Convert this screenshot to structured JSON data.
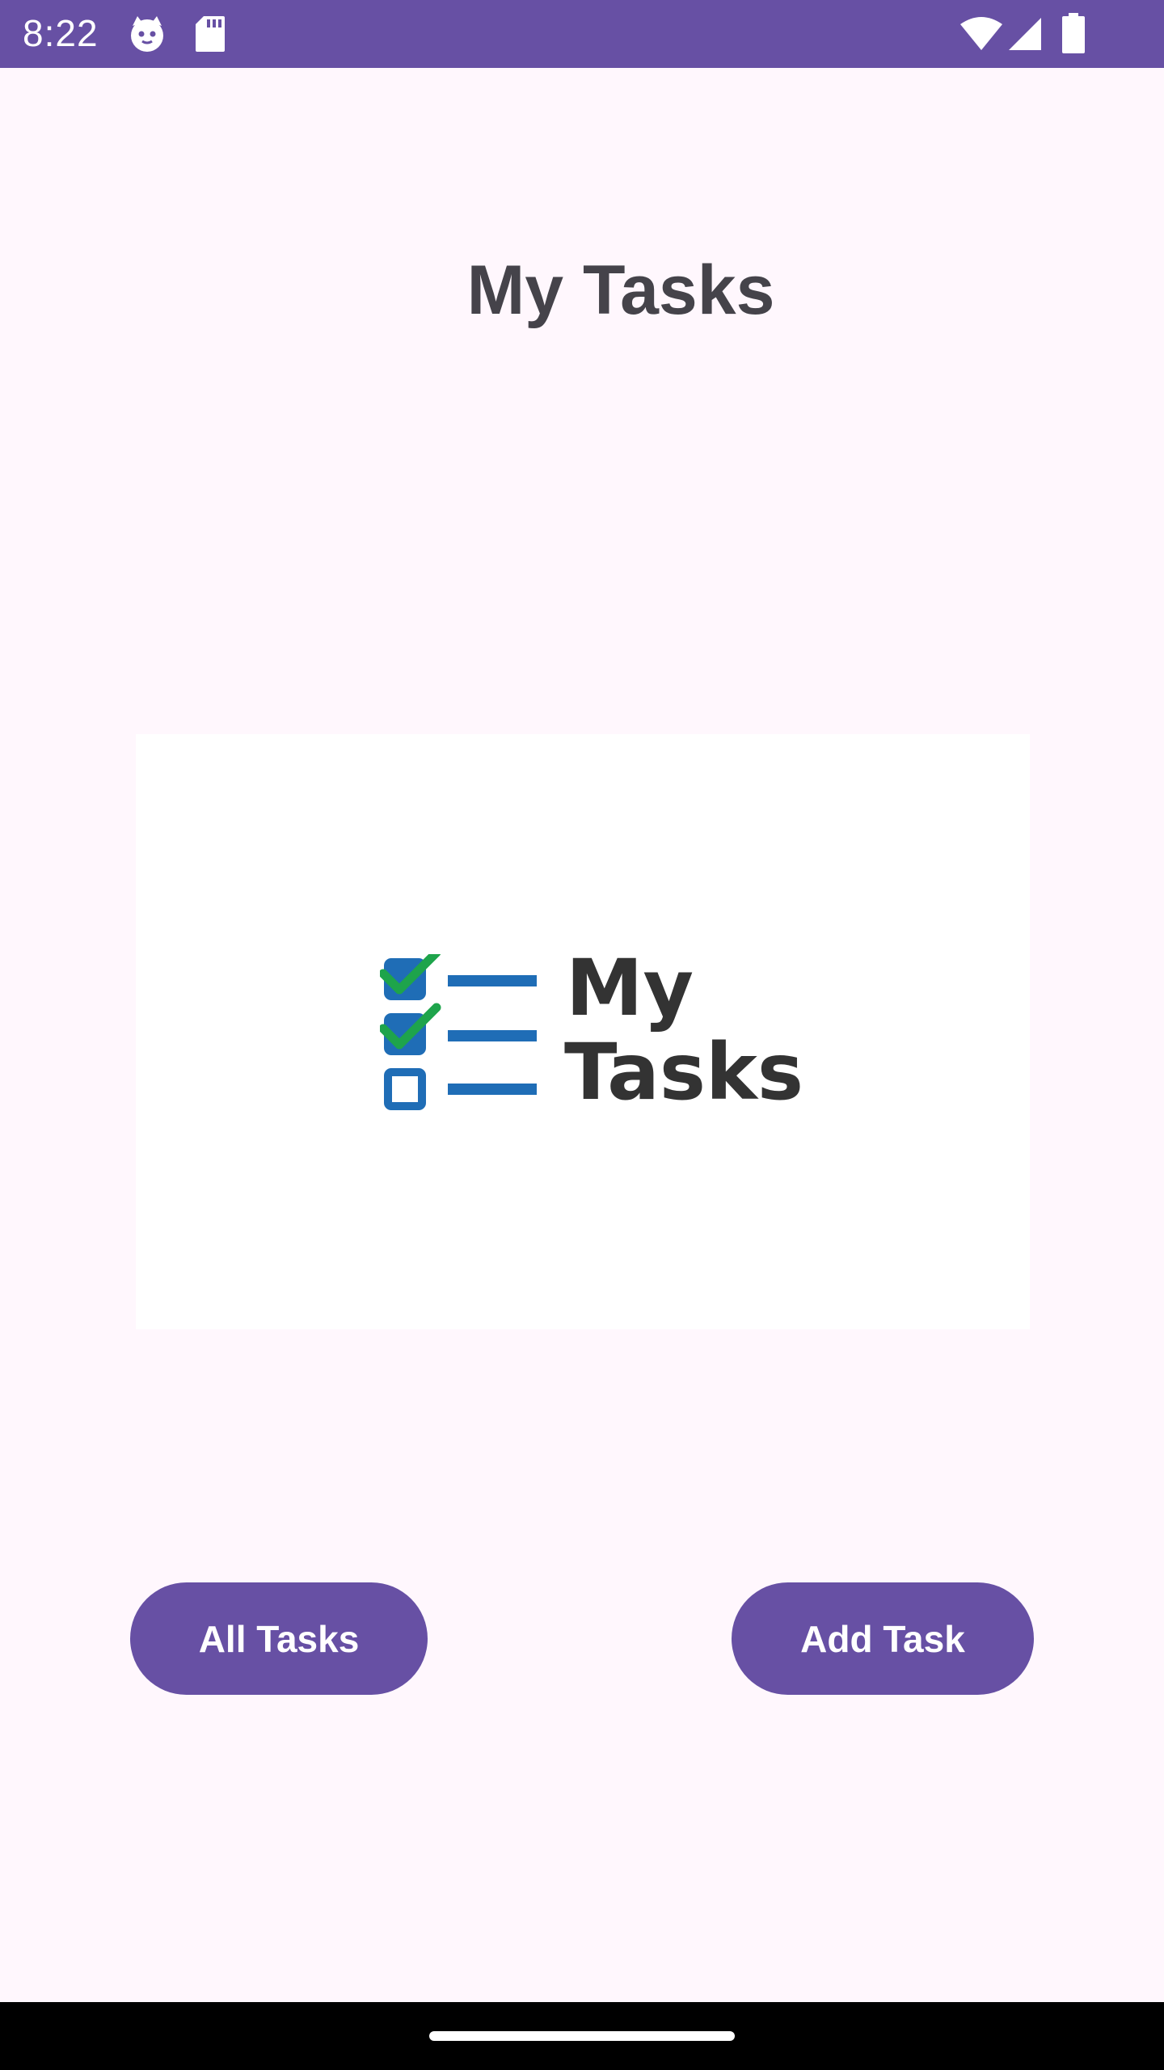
{
  "status_bar": {
    "time": "8:22",
    "icons": [
      "cat-face-icon",
      "sd-card-icon",
      "wifi-icon",
      "signal-icon",
      "battery-icon"
    ],
    "color": "#6750A4"
  },
  "main": {
    "title": "My Tasks",
    "logo": {
      "line1": "My",
      "line2": "Tasks",
      "check_color": "#1EA44B",
      "box_color": "#1F6DB6",
      "text_color": "#333333"
    }
  },
  "buttons": {
    "all_tasks_label": "All Tasks",
    "add_task_label": "Add Task",
    "color": "#6750A4"
  },
  "nav_bar": {
    "handle": "home-gesture-handle"
  }
}
